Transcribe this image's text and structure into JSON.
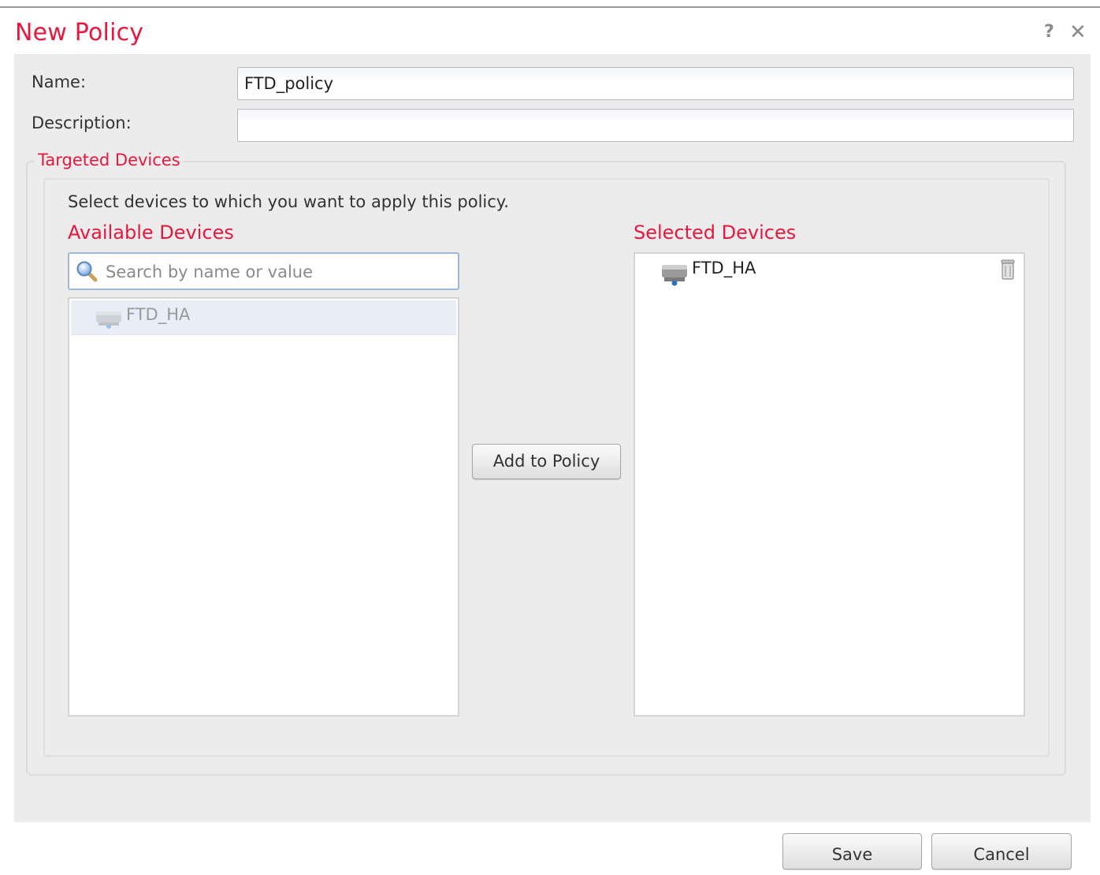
{
  "dialog": {
    "title": "New Policy",
    "help_label": "?",
    "close_label": "✕"
  },
  "form": {
    "name_label": "Name:",
    "name_value": "FTD_policy",
    "description_label": "Description:",
    "description_value": ""
  },
  "targeted": {
    "legend": "Targeted Devices",
    "instruction": "Select devices to which you want to apply this policy.",
    "available_title": "Available Devices",
    "search_placeholder": "Search by name or value",
    "available_items": [
      {
        "label": "FTD_HA"
      }
    ],
    "add_button": "Add to Policy",
    "selected_title": "Selected Devices",
    "selected_items": [
      {
        "label": "FTD_HA"
      }
    ]
  },
  "footer": {
    "save_label": "Save",
    "cancel_label": "Cancel"
  },
  "colors": {
    "accent": "#e8173e",
    "panel_bg": "#ececec"
  },
  "icons": {
    "search": "magnifier-icon",
    "device": "device-icon",
    "delete": "trash-icon"
  }
}
